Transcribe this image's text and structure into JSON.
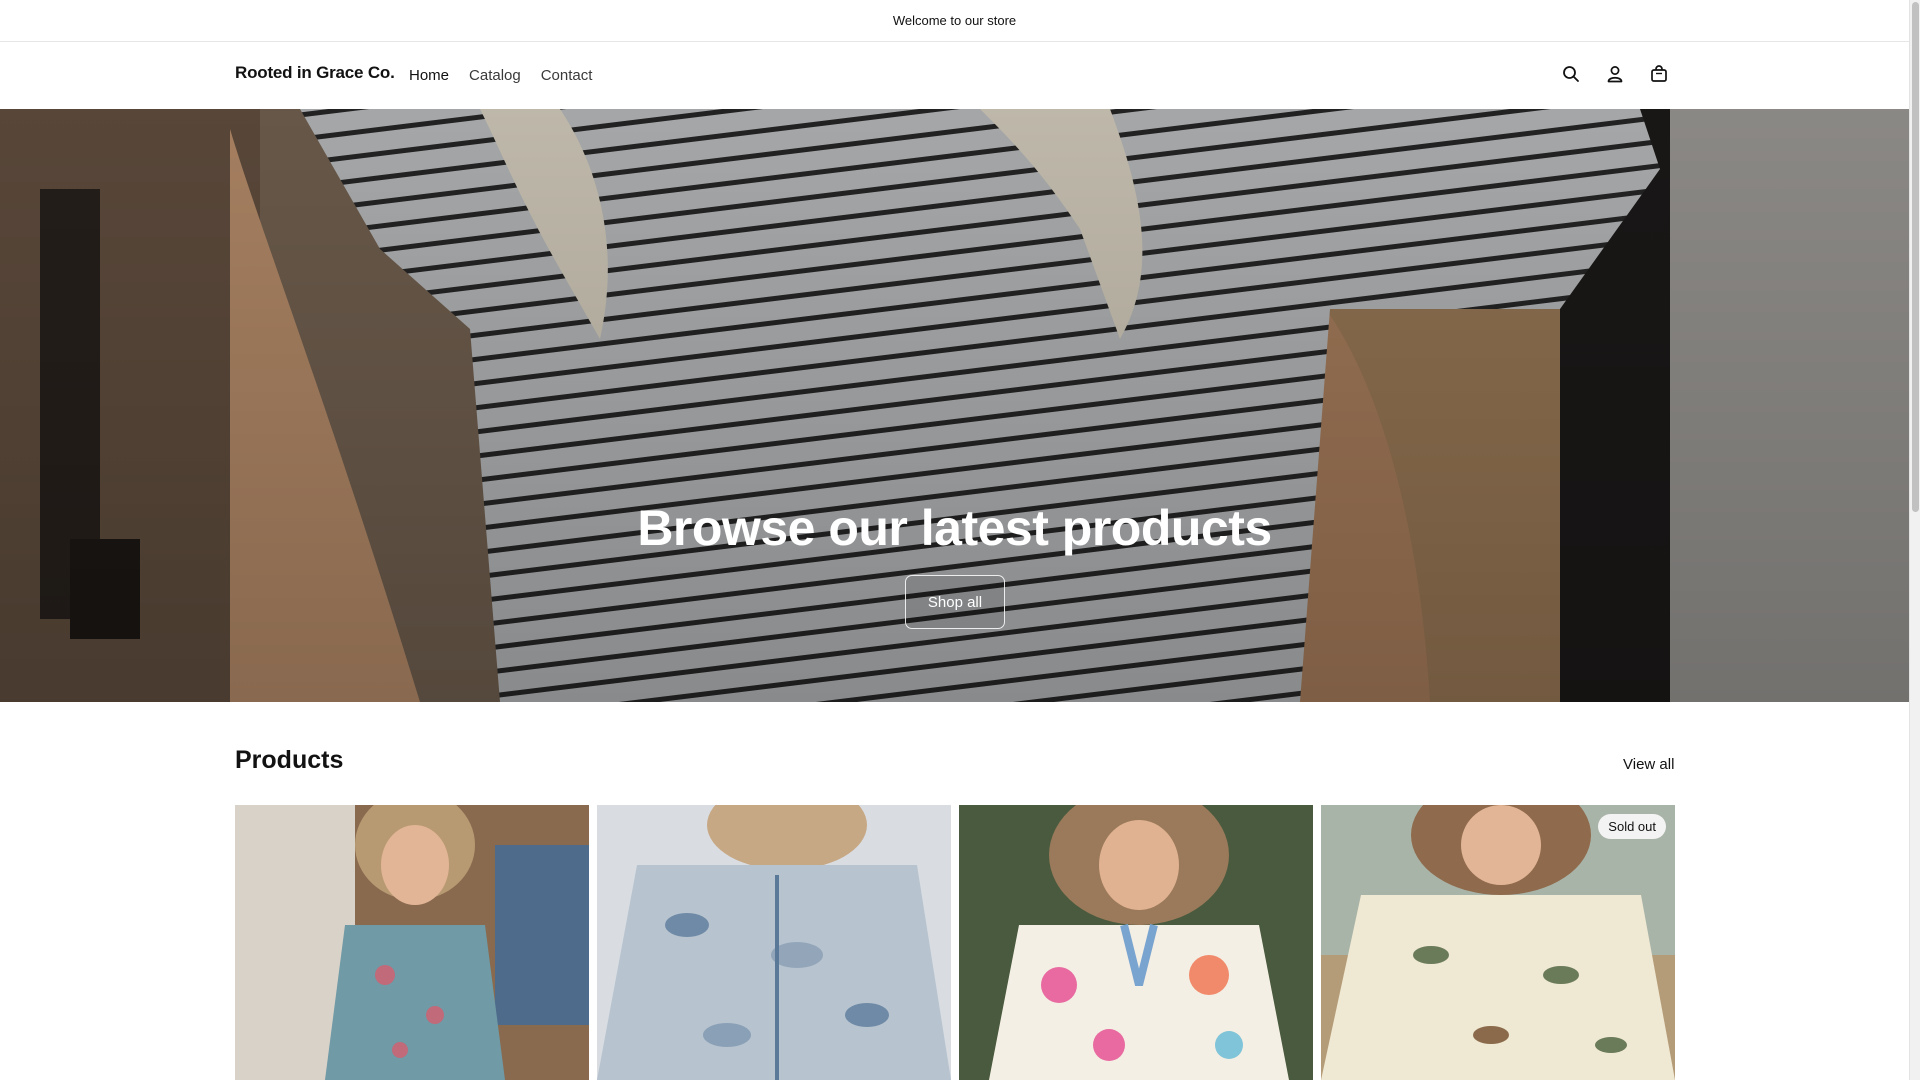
{
  "announcement": {
    "text": "Welcome to our store"
  },
  "header": {
    "logo": "Rooted in Grace Co.",
    "nav": [
      {
        "label": "Home"
      },
      {
        "label": "Catalog"
      },
      {
        "label": "Contact"
      }
    ],
    "icons": [
      "search-icon",
      "account-icon",
      "cart-icon"
    ]
  },
  "hero": {
    "title": "Browse our latest products",
    "button_label": "Shop all"
  },
  "products": {
    "title": "Products",
    "view_all": "View all",
    "items": [
      {
        "image": "floral-overalls",
        "badge": ""
      },
      {
        "image": "camo-pajama-shirt",
        "badge": ""
      },
      {
        "image": "floral-v-neck-blouse",
        "badge": ""
      },
      {
        "image": "duck-print-sweatshirt",
        "badge": "Sold out"
      }
    ]
  },
  "colors": {
    "text": "#121212",
    "background": "#ffffff",
    "badge_bg": "#f3f3f3"
  }
}
